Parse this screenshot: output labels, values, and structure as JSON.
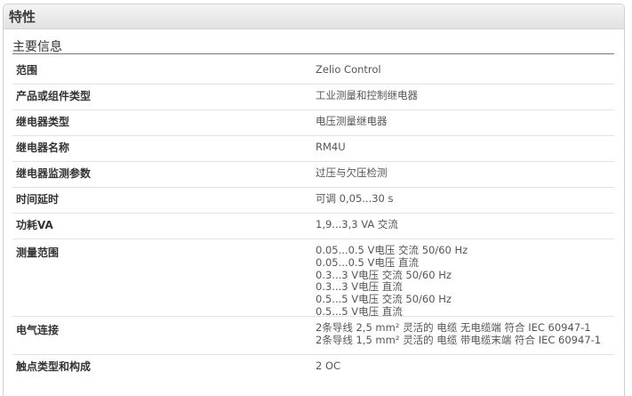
{
  "panel": {
    "title": "特性"
  },
  "section": {
    "title": "主要信息"
  },
  "rows": [
    {
      "label": "范围",
      "values": [
        "Zelio Control"
      ]
    },
    {
      "label": "产品或组件类型",
      "values": [
        "工业测量和控制继电器"
      ]
    },
    {
      "label": "继电器类型",
      "values": [
        "电压测量继电器"
      ]
    },
    {
      "label": "继电器名称",
      "values": [
        "RM4U"
      ]
    },
    {
      "label": "继电器监测参数",
      "values": [
        "过压与欠压检测"
      ]
    },
    {
      "label": "时间延时",
      "values": [
        "可调 0,05...30 s"
      ]
    },
    {
      "label": "功耗VA",
      "values": [
        "1,9...3,3 VA 交流"
      ]
    },
    {
      "label": "测量范围",
      "values": [
        "0.05...0.5 V电压 交流 50/60 Hz",
        "0.05...0.5 V电压 直流",
        "0.3...3 V电压 交流 50/60 Hz",
        "0.3...3 V电压 直流",
        "0.5...5 V电压 交流 50/60 Hz",
        "0.5...5 V电压 直流"
      ]
    },
    {
      "label": "电气连接",
      "values": [
        "2条导线 2,5 mm² 灵活的 电缆 无电缆端 符合 IEC 60947-1",
        "2条导线 1,5 mm² 灵活的 电缆 带电缆末端 符合 IEC 60947-1"
      ]
    },
    {
      "label": "触点类型和构成",
      "values": [
        "2 OC"
      ]
    }
  ]
}
